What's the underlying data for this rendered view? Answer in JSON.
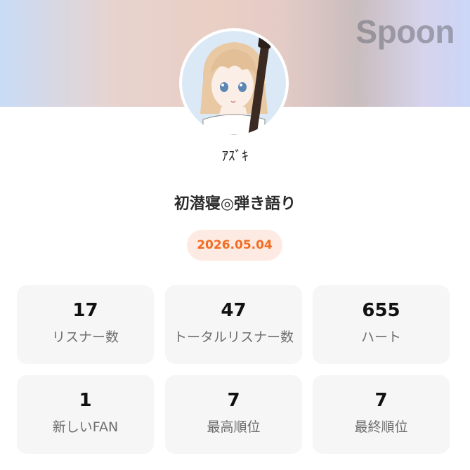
{
  "header": {
    "brand": "Spoon",
    "banner_colors": [
      "#c9dcf6",
      "#e9cfc4",
      "#c9bdbe",
      "#cbd6f6"
    ]
  },
  "profile": {
    "username": "ｱｽﾞｷ",
    "avatar_icon": "avatar-girl-with-guitar"
  },
  "live": {
    "title": "初潜寝◎弾き語り",
    "date": "2026.05.04",
    "accent_color": "#f26c22"
  },
  "stats": [
    {
      "value": "17",
      "label": "リスナー数"
    },
    {
      "value": "47",
      "label": "トータルリスナー数"
    },
    {
      "value": "655",
      "label": "ハート"
    },
    {
      "value": "1",
      "label": "新しいFAN"
    },
    {
      "value": "7",
      "label": "最高順位"
    },
    {
      "value": "7",
      "label": "最終順位"
    }
  ]
}
